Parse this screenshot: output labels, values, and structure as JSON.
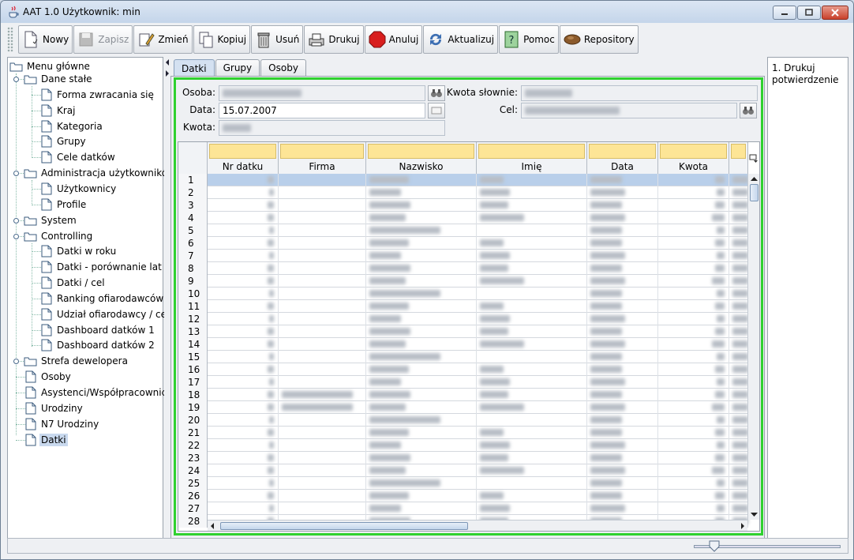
{
  "window": {
    "title": "AAT 1.0  Użytkownik: min"
  },
  "toolbar": [
    {
      "label": "Nowy",
      "icon": "new-document-icon",
      "enabled": true
    },
    {
      "label": "Zapisz",
      "icon": "floppy-disk-icon",
      "enabled": false
    },
    {
      "label": "Zmień",
      "icon": "pencil-edit-icon",
      "enabled": true
    },
    {
      "label": "Kopiuj",
      "icon": "copy-icon",
      "enabled": true
    },
    {
      "label": "Usuń",
      "icon": "trash-icon",
      "enabled": true
    },
    {
      "label": "Drukuj",
      "icon": "printer-icon",
      "enabled": true
    },
    {
      "label": "Anuluj",
      "icon": "stop-icon",
      "enabled": true
    },
    {
      "label": "Aktualizuj",
      "icon": "refresh-icon",
      "enabled": true
    },
    {
      "label": "Pomoc",
      "icon": "help-icon",
      "enabled": true
    },
    {
      "label": "Repository",
      "icon": "repository-icon",
      "enabled": true
    }
  ],
  "tree": {
    "root": "Menu główne",
    "nodes": [
      {
        "label": "Dane stałe",
        "type": "folder",
        "level": 1
      },
      {
        "label": "Forma zwracania się",
        "type": "doc",
        "level": 2
      },
      {
        "label": "Kraj",
        "type": "doc",
        "level": 2
      },
      {
        "label": "Kategoria",
        "type": "doc",
        "level": 2
      },
      {
        "label": "Grupy",
        "type": "doc",
        "level": 2
      },
      {
        "label": "Cele datków",
        "type": "doc",
        "level": 2
      },
      {
        "label": "Administracja użytkowników",
        "type": "folder",
        "level": 1
      },
      {
        "label": "Użytkownicy",
        "type": "doc",
        "level": 2
      },
      {
        "label": "Profile",
        "type": "doc",
        "level": 2
      },
      {
        "label": "System",
        "type": "folder",
        "level": 1
      },
      {
        "label": "Controlling",
        "type": "folder",
        "level": 1
      },
      {
        "label": "Datki w roku",
        "type": "doc",
        "level": 2
      },
      {
        "label": "Datki - porównanie lat",
        "type": "doc",
        "level": 2
      },
      {
        "label": "Datki / cel",
        "type": "doc",
        "level": 2
      },
      {
        "label": "Ranking ofiarodawców",
        "type": "doc",
        "level": 2
      },
      {
        "label": "Udział ofiarodawcy / cel",
        "type": "doc",
        "level": 2
      },
      {
        "label": "Dashboard datków 1",
        "type": "doc",
        "level": 2
      },
      {
        "label": "Dashboard datków 2",
        "type": "doc",
        "level": 2
      },
      {
        "label": "Strefa dewelopera",
        "type": "folder",
        "level": 1
      },
      {
        "label": "Osoby",
        "type": "doc",
        "level": 1
      },
      {
        "label": "Asystenci/Współpracownicy",
        "type": "doc",
        "level": 1
      },
      {
        "label": "Urodziny",
        "type": "doc",
        "level": 1
      },
      {
        "label": "N7 Urodziny",
        "type": "doc",
        "level": 1
      },
      {
        "label": "Datki",
        "type": "doc",
        "level": 1,
        "selected": true
      }
    ]
  },
  "tabs": [
    {
      "label": "Datki",
      "active": true
    },
    {
      "label": "Grupy",
      "active": false
    },
    {
      "label": "Osoby",
      "active": false
    }
  ],
  "form": {
    "osoba_label": "Osoba:",
    "data_label": "Data:",
    "data_value": "15.07.2007",
    "kwota_label": "Kwota:",
    "kwota_slownie_label": "Kwota słownie:",
    "cel_label": "Cel:"
  },
  "table": {
    "columns": [
      "Nr datku",
      "Firma",
      "Nazwisko",
      "Imię",
      "Data",
      "Kwota"
    ],
    "row_numbers": [
      "1",
      "2",
      "3",
      "4",
      "5",
      "6",
      "7",
      "8",
      "9",
      "10",
      "11",
      "12",
      "13",
      "14",
      "15",
      "16",
      "17",
      "18",
      "19",
      "20",
      "21",
      "22",
      "23",
      "24",
      "25",
      "26",
      "27",
      "28"
    ]
  },
  "right_panel": {
    "text": "1. Drukuj potwierdzenie"
  },
  "colors": {
    "selection_border": "#2fd12f",
    "filter_cell": "#fde596",
    "selected_row": "#b9cfea"
  }
}
